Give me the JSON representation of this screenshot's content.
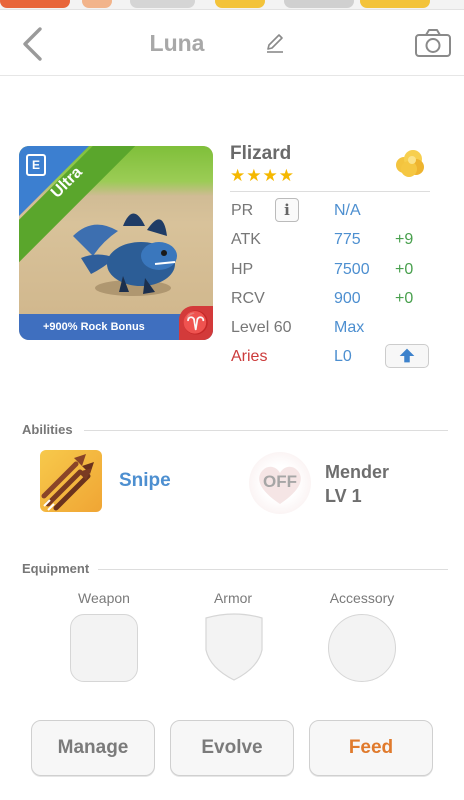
{
  "header": {
    "title": "Luna"
  },
  "card": {
    "rarity": "Ultra",
    "badge": "E",
    "bonus": "+900% Rock Bonus",
    "sign_glyph": "♈"
  },
  "monster": {
    "name": "Flizard",
    "stars": "★★★★",
    "star_count": 4
  },
  "stats": {
    "pr": {
      "label": "PR",
      "value": "N/A"
    },
    "atk": {
      "label": "ATK",
      "value": "775",
      "bonus": "+9"
    },
    "hp": {
      "label": "HP",
      "value": "7500",
      "bonus": "+0"
    },
    "rcv": {
      "label": "RCV",
      "value": "900",
      "bonus": "+0"
    },
    "level": {
      "label": "Level 60",
      "value": "Max"
    },
    "zodiac": {
      "label": "Aries",
      "value": "L0"
    }
  },
  "abilities": {
    "section_title": "Abilities",
    "primary": {
      "name": "Snipe"
    },
    "leader": {
      "status": "OFF",
      "name": "Mender",
      "level": "LV 1"
    }
  },
  "equipment": {
    "section_title": "Equipment",
    "slots": [
      {
        "label": "Weapon"
      },
      {
        "label": "Armor"
      },
      {
        "label": "Accessory"
      }
    ]
  },
  "actions": {
    "manage": "Manage",
    "evolve": "Evolve",
    "feed": "Feed"
  },
  "colors": {
    "accent_blue": "#4d8fd0",
    "bonus_green": "#49a04e",
    "aries_red": "#cc3b3b",
    "feed_orange": "#e07a2c"
  }
}
